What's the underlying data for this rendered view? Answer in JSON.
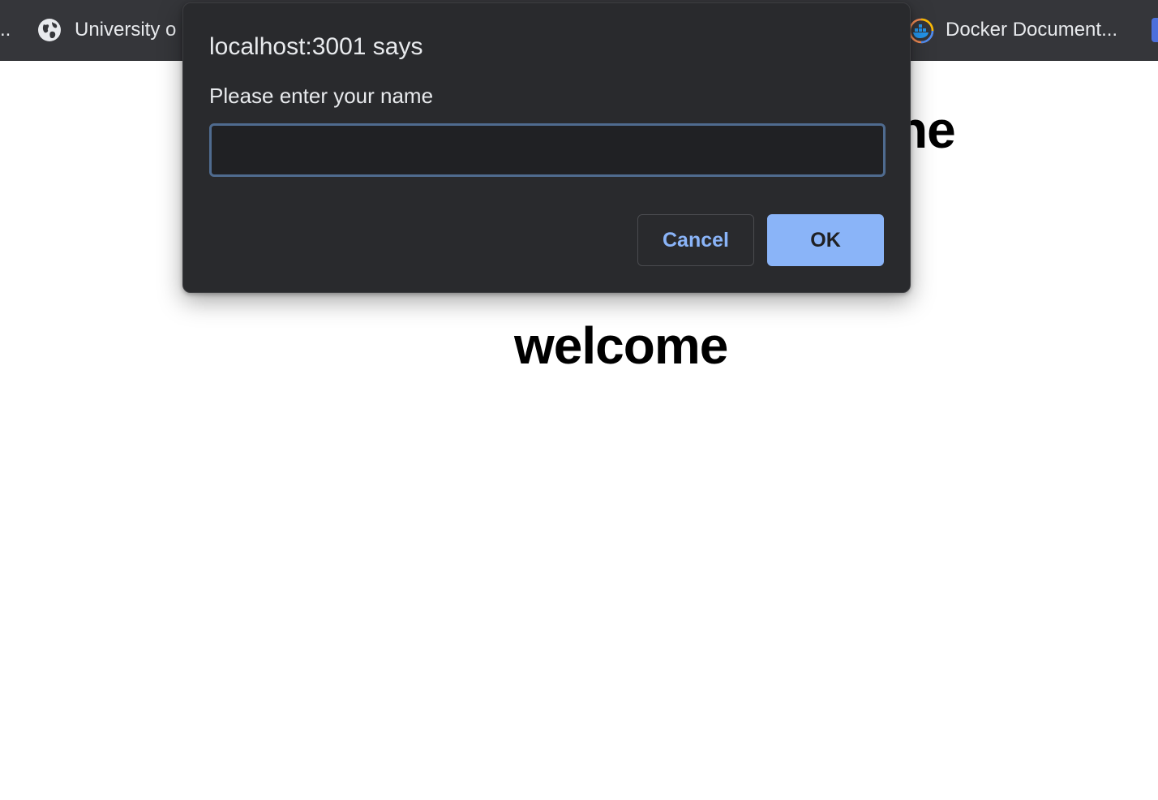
{
  "bookmarks_bar": {
    "overflow_text": "..",
    "items": [
      {
        "label": "University o",
        "icon": "globe-icon"
      },
      {
        "label": "Docker Document...",
        "icon": "docker-icon"
      }
    ]
  },
  "page": {
    "heading_fragment": "ne",
    "welcome_text": "welcome"
  },
  "dialog": {
    "title": "localhost:3001 says",
    "message": "Please enter your name",
    "input_value": "",
    "cancel_label": "Cancel",
    "ok_label": "OK"
  },
  "colors": {
    "dialog_background": "#292a2d",
    "accent": "#8ab4f8",
    "bookmarks_bar": "#35363a"
  }
}
